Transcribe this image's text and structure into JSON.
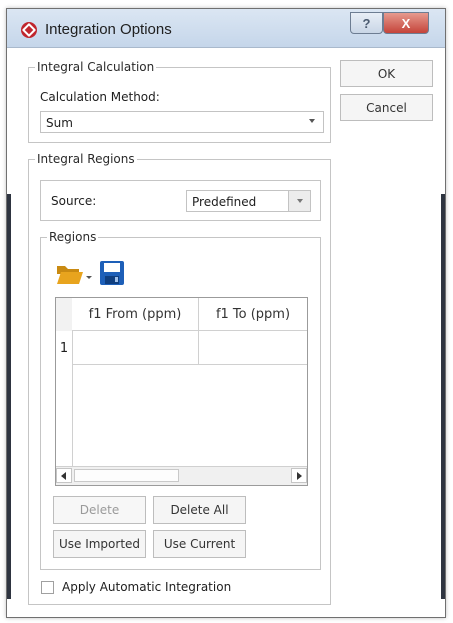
{
  "window": {
    "title": "Integration Options",
    "help_glyph": "?",
    "close_glyph": "X"
  },
  "buttons": {
    "ok": "OK",
    "cancel": "Cancel"
  },
  "integral_calculation": {
    "legend": "Integral Calculation",
    "method_label": "Calculation Method:",
    "method_value": "Sum"
  },
  "integral_regions": {
    "legend": "Integral Regions",
    "source_label": "Source:",
    "source_value": "Predefined",
    "regions": {
      "legend": "Regions",
      "grid": {
        "columns": [
          "f1 From (ppm)",
          "f1 To (ppm)"
        ],
        "rows": [
          {
            "index": "1",
            "cells": [
              "",
              ""
            ]
          }
        ]
      },
      "actions": {
        "delete": "Delete",
        "delete_all": "Delete All",
        "use_imported": "Use Imported",
        "use_current": "Use Current"
      }
    }
  },
  "apply_automatic": {
    "label": "Apply Automatic Integration",
    "checked": false
  },
  "colors": {
    "accent_red": "#c0262d",
    "folder_yellow": "#e8a41e",
    "floppy_blue": "#1d5fb8"
  },
  "icons": [
    "app-logo-icon",
    "help-icon",
    "close-icon",
    "open-folder-icon",
    "save-disk-icon"
  ]
}
